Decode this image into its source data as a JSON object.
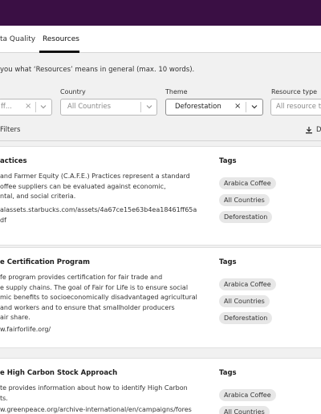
{
  "tabs": {
    "data_quality": "ta Quality",
    "resources": "Resources"
  },
  "instruction": "you what ‘Resources’ means in general (max. 10 words).",
  "filters": {
    "first": {
      "value": "ff..."
    },
    "country": {
      "label": "Country",
      "placeholder": "All Countries"
    },
    "theme": {
      "label": "Theme",
      "value": "Deforestation"
    },
    "resource_type": {
      "label": "Resource type",
      "placeholder": "All resource ty"
    }
  },
  "filters_link": "Filters",
  "download_label": "D",
  "tags_heading": "Tags",
  "resources": [
    {
      "title": "actices",
      "description": [
        "and Farmer Equity (C.A.F.E.) Practices represent a standard",
        "offee suppliers can be evaluated against economic,",
        "ntal, and social criteria."
      ],
      "link": [
        "alassets.starbucks.com/assets/4a67ce15e63b4ea18461ff65a",
        "df"
      ],
      "tags": [
        "Arabica Coffee",
        "All Countries",
        "Deforestation"
      ]
    },
    {
      "title": "e Certification Program",
      "description": [
        "fe program provides certification for fair trade and",
        "e supply chains. The goal of Fair for Life is to ensure social",
        "mic benefits to socioeconomically disadvantaged agricultural",
        "and workers and to ensure that smallholder producers",
        "air share."
      ],
      "link": [
        "w.fairforlife.org/"
      ],
      "tags": [
        "Arabica Coffee",
        "All Countries",
        "Deforestation"
      ]
    },
    {
      "title": "e High Carbon Stock Approach",
      "description": [
        "te provides information about how to identify High Carbon",
        "ts."
      ],
      "link": [
        "w.greenpeace.org/archive-international/en/campaigns/fores"
      ],
      "tags": [
        "Arabica Coffee",
        "All Countries"
      ]
    }
  ],
  "colors": {
    "topbar": "#3a0f44",
    "background": "#f1f1f1",
    "card": "#ffffff",
    "tag": "#e7e7e7"
  }
}
